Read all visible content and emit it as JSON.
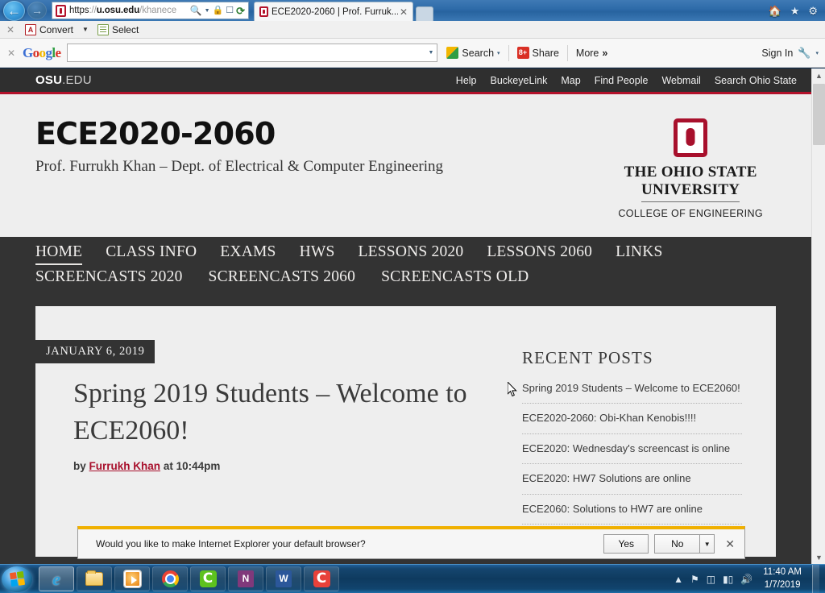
{
  "browser": {
    "back_label": "←",
    "forward_label": "→",
    "address": {
      "scheme": "https",
      "sep": "://",
      "host": "u.osu.edu",
      "path": "/khanece",
      "full": "https://u.osu.edu/khanece"
    },
    "address_icons": [
      "search-icon",
      "dropdown-caret",
      "lock-icon",
      "compatibility-icon",
      "refresh-icon"
    ],
    "tab_title": "ECE2020-2060 | Prof. Furruk...",
    "tab_close": "✕",
    "right_icons": [
      "home-icon",
      "favorites-star-icon",
      "settings-gear-icon"
    ]
  },
  "adobe_toolbar": {
    "close": "✕",
    "convert_label": "Convert",
    "caret": "▼",
    "select_label": "Select"
  },
  "google_toolbar": {
    "close": "✕",
    "logo": [
      {
        "letter": "G",
        "class": "b"
      },
      {
        "letter": "o",
        "class": "r"
      },
      {
        "letter": "o",
        "class": "y"
      },
      {
        "letter": "g",
        "class": "b"
      },
      {
        "letter": "l",
        "class": "g"
      },
      {
        "letter": "e",
        "class": "r"
      }
    ],
    "search_value": "",
    "search_placeholder": "",
    "dropdown_caret": "▼",
    "search_label": "Search",
    "search_caret": "▾",
    "share_label": "Share",
    "share_glyph": "8+",
    "more_label": "More",
    "more_glyph": "»",
    "signin_label": "Sign In",
    "wrench_glyph": "🔧",
    "wrench_caret": "▾"
  },
  "osu_bar": {
    "brand_bold": "OSU",
    "brand_rest": ".EDU",
    "links": [
      "Help",
      "BuckeyeLink",
      "Map",
      "Find People",
      "Webmail",
      "Search Ohio State"
    ]
  },
  "site_header": {
    "title": "ECE2020-2060",
    "tagline": "Prof. Furrukh Khan – Dept. of Electrical & Computer Engineering",
    "logo_line1": "THE OHIO STATE",
    "logo_line2": "UNIVERSITY",
    "logo_line3": "COLLEGE OF ENGINEERING"
  },
  "nav": {
    "row1": [
      {
        "label": "HOME",
        "active": true
      },
      {
        "label": "CLASS INFO",
        "active": false
      },
      {
        "label": "EXAMS",
        "active": false
      },
      {
        "label": "HWS",
        "active": false
      },
      {
        "label": "LESSONS 2020",
        "active": false
      },
      {
        "label": "LESSONS 2060",
        "active": false
      },
      {
        "label": "LINKS",
        "active": false
      }
    ],
    "row2": [
      {
        "label": "SCREENCASTS 2020",
        "active": false
      },
      {
        "label": "SCREENCASTS 2060",
        "active": false
      },
      {
        "label": "SCREENCASTS OLD",
        "active": false
      }
    ]
  },
  "post": {
    "date": "JANUARY 6, 2019",
    "title": "Spring 2019 Students – Welcome to ECE2060!",
    "meta_by": "by",
    "meta_author": "Furrukh Khan",
    "meta_at": "at",
    "meta_time": "10:44pm"
  },
  "sidebar": {
    "title": "RECENT POSTS",
    "posts": [
      "Spring 2019 Students – Welcome to ECE2060!",
      "ECE2020-2060: Obi-Khan Kenobis!!!!",
      "ECE2020: Wednesday's screencast is online",
      "ECE2020: HW7 Solutions are online",
      "ECE2060: Solutions to HW7 are online"
    ]
  },
  "notification": {
    "message": "Would you like to make Internet Explorer your default browser?",
    "yes_label": "Yes",
    "no_label": "No",
    "caret": "▼",
    "close": "✕"
  },
  "taskbar": {
    "start_label": "start-orb",
    "apps": [
      {
        "name": "internet-explorer",
        "class": "app-ie",
        "glyph": "e",
        "active": true
      },
      {
        "name": "file-explorer",
        "class": "app-folder",
        "glyph": "",
        "active": false
      },
      {
        "name": "media-player",
        "class": "app-media",
        "glyph": "",
        "active": false
      },
      {
        "name": "google-chrome",
        "class": "app-chrome",
        "glyph": "",
        "active": false
      },
      {
        "name": "camtasia-studio",
        "class": "app-camtasia",
        "glyph": "C",
        "active": false
      },
      {
        "name": "microsoft-onenote",
        "class": "app-onenote",
        "glyph": "N",
        "active": false
      },
      {
        "name": "microsoft-word",
        "class": "app-word",
        "glyph": "W",
        "active": false
      },
      {
        "name": "camtasia-recorder",
        "class": "app-camtasia2",
        "glyph": "C",
        "active": false
      }
    ],
    "tray_icons": [
      "show-hidden-icons",
      "flag-action-center",
      "battery-icon",
      "network-icon",
      "volume-icon"
    ],
    "clock_time": "11:40 AM",
    "clock_date": "1/7/2019"
  },
  "colors": {
    "osu_red": "#b3122b",
    "logo_red": "#a8102c",
    "dark_nav": "#333333",
    "page_bg": "#eeeeee",
    "notify_accent": "#f0b000",
    "link_red": "#a8102c"
  }
}
